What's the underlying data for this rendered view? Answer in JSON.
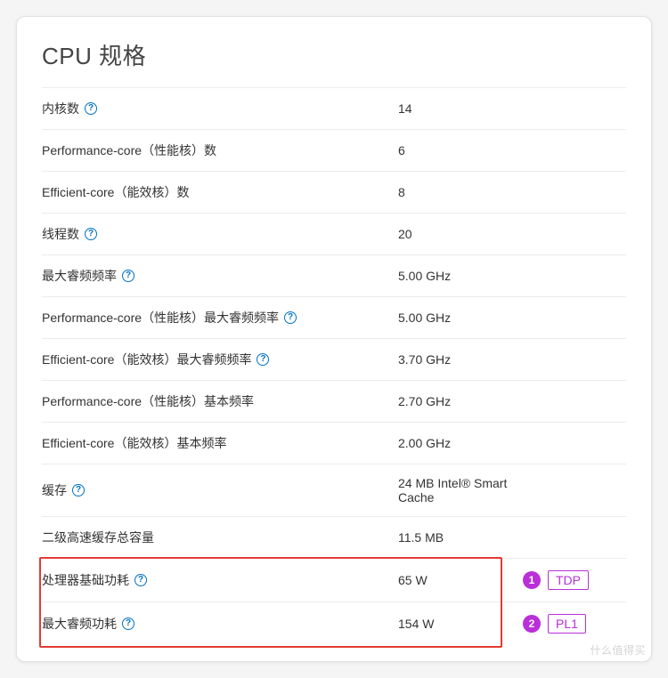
{
  "title": "CPU 规格",
  "help_glyph": "?",
  "rows": [
    {
      "label": "内核数",
      "help": true,
      "value": "14"
    },
    {
      "label": "Performance-core（性能核）数",
      "help": false,
      "value": "6"
    },
    {
      "label": "Efficient-core（能效核）数",
      "help": false,
      "value": "8"
    },
    {
      "label": "线程数",
      "help": true,
      "value": "20"
    },
    {
      "label": "最大睿频频率",
      "help": true,
      "value": "5.00 GHz"
    },
    {
      "label": "Performance-core（性能核）最大睿频频率",
      "help": true,
      "value": "5.00 GHz"
    },
    {
      "label": "Efficient-core（能效核）最大睿频频率",
      "help": true,
      "value": "3.70 GHz"
    },
    {
      "label": "Performance-core（性能核）基本频率",
      "help": false,
      "value": "2.70 GHz"
    },
    {
      "label": "Efficient-core（能效核）基本频率",
      "help": false,
      "value": "2.00 GHz"
    },
    {
      "label": "缓存",
      "help": true,
      "value": "24 MB Intel® Smart Cache"
    },
    {
      "label": "二级高速缓存总容量",
      "help": false,
      "value": "11.5 MB"
    },
    {
      "label": "处理器基础功耗",
      "help": true,
      "value": "65 W",
      "anno_num": "1",
      "anno_text": "TDP"
    },
    {
      "label": "最大睿频功耗",
      "help": true,
      "value": "154 W",
      "anno_num": "2",
      "anno_text": "PL1"
    }
  ],
  "watermark": "什么值得买"
}
